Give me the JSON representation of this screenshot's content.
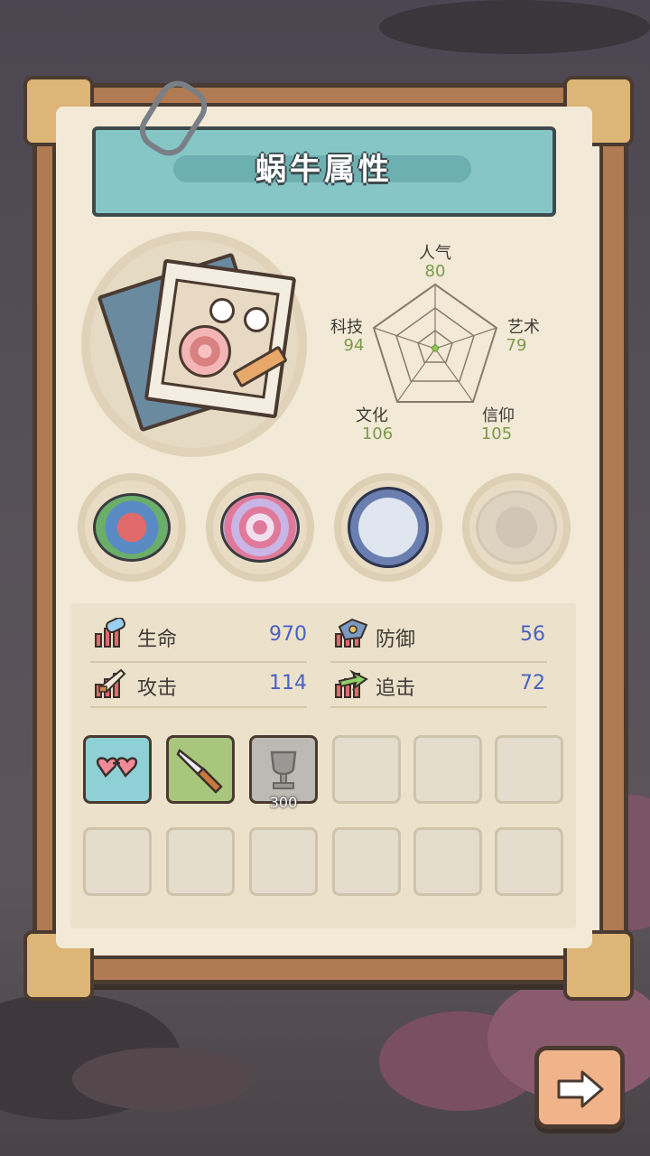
{
  "title": "蜗牛属性",
  "radar": {
    "stats": [
      {
        "name": "人气",
        "value": "80"
      },
      {
        "name": "艺术",
        "value": "79"
      },
      {
        "name": "信仰",
        "value": "105"
      },
      {
        "name": "文化",
        "value": "106"
      },
      {
        "name": "科技",
        "value": "94"
      }
    ]
  },
  "relics": [
    {
      "name": "tentacle-ball-icon"
    },
    {
      "name": "spiral-shell-icon"
    },
    {
      "name": "compass-icon"
    },
    {
      "name": "chained-orb-icon",
      "locked": true
    }
  ],
  "attributes": [
    {
      "label": "生命",
      "value": "970",
      "icon": "health-icon"
    },
    {
      "label": "防御",
      "value": "56",
      "icon": "defense-icon"
    },
    {
      "label": "攻击",
      "value": "114",
      "icon": "attack-icon"
    },
    {
      "label": "追击",
      "value": "72",
      "icon": "pursuit-icon"
    }
  ],
  "equipment": {
    "slots": [
      {
        "item": "heart-glasses-icon",
        "bg": "#8fd0d6"
      },
      {
        "item": "knife-icon",
        "bg": "#a9c77c"
      },
      {
        "item": "trophy-icon",
        "bg": "#bdbab5",
        "count": "300"
      }
    ]
  },
  "colors": {
    "banner": "#86c6c6",
    "value_blue": "#4a62c4",
    "value_green": "#7a9a4e",
    "next_button": "#f0b38a"
  }
}
